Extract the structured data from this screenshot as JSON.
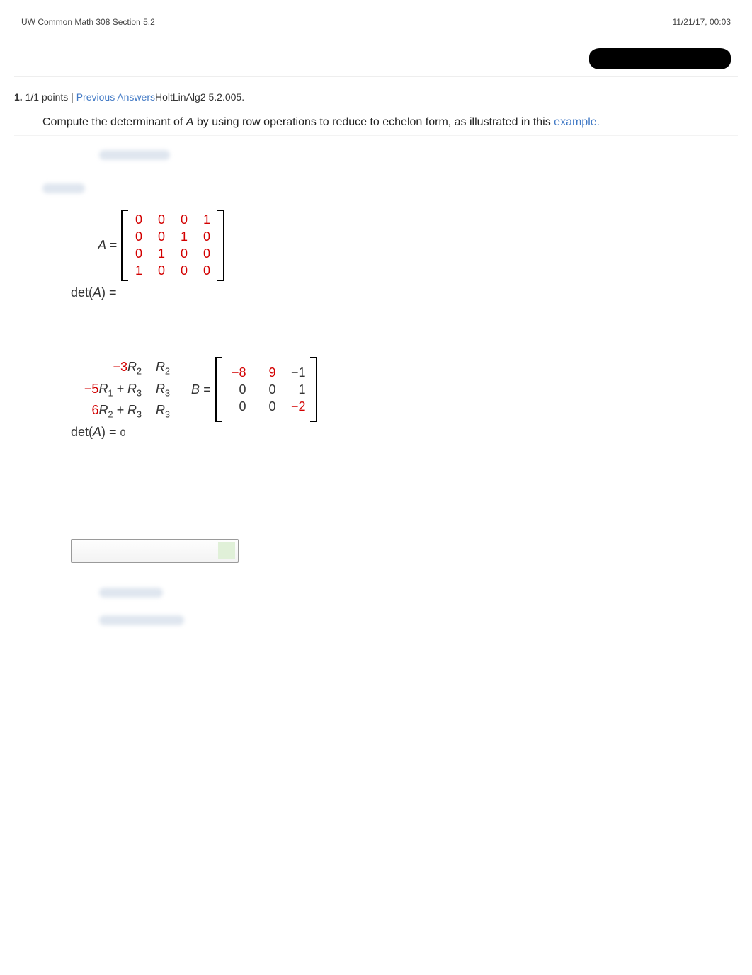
{
  "header": {
    "left": "UW Common Math 308 Section 5.2",
    "right": "11/21/17, 00:03"
  },
  "question": {
    "number": "1.",
    "points": "1/1 points  |  ",
    "prev_answers": "Previous Answers",
    "source": "HoltLinAlg2 5.2.005.",
    "prompt_a": "Compute the determinant of ",
    "prompt_var": "A",
    "prompt_b": " by using row operations to reduce to echelon form, as illustrated in this ",
    "example_link": "example."
  },
  "matrixA": {
    "label_var": "A",
    "label_eq": " = ",
    "rows": [
      [
        "0",
        "0",
        "0",
        "1"
      ],
      [
        "0",
        "0",
        "1",
        "0"
      ],
      [
        "0",
        "1",
        "0",
        "0"
      ],
      [
        "1",
        "0",
        "0",
        "0"
      ]
    ]
  },
  "detA_label_a": "det(",
  "detA_label_var": "A",
  "detA_label_b": ") = ",
  "row_ops": [
    {
      "coef": "−3",
      "r_from": "R",
      "from_sub": "2",
      "plus": "",
      "target": "R",
      "target_sub": "2"
    },
    {
      "coef": "−5",
      "r_from": "R",
      "from_sub": "1",
      "plus": " + R",
      "plus_sub": "3",
      "target": "R",
      "target_sub": "3"
    },
    {
      "coef": "6",
      "r_from": "R",
      "from_sub": "2",
      "plus": " + R",
      "plus_sub": "3",
      "target": "R",
      "target_sub": "3"
    }
  ],
  "matrixB": {
    "label_var": "B",
    "label_eq": " = ",
    "rows": [
      [
        {
          "v": "−8",
          "r": true
        },
        {
          "v": "9",
          "r": true
        },
        {
          "v": "−1",
          "r": false
        }
      ],
      [
        {
          "v": "0",
          "r": false
        },
        {
          "v": "0",
          "r": false
        },
        {
          "v": "1",
          "r": false
        }
      ],
      [
        {
          "v": "0",
          "r": false
        },
        {
          "v": "0",
          "r": false
        },
        {
          "v": "−2",
          "r": true
        }
      ]
    ]
  },
  "detA2_value": "0"
}
